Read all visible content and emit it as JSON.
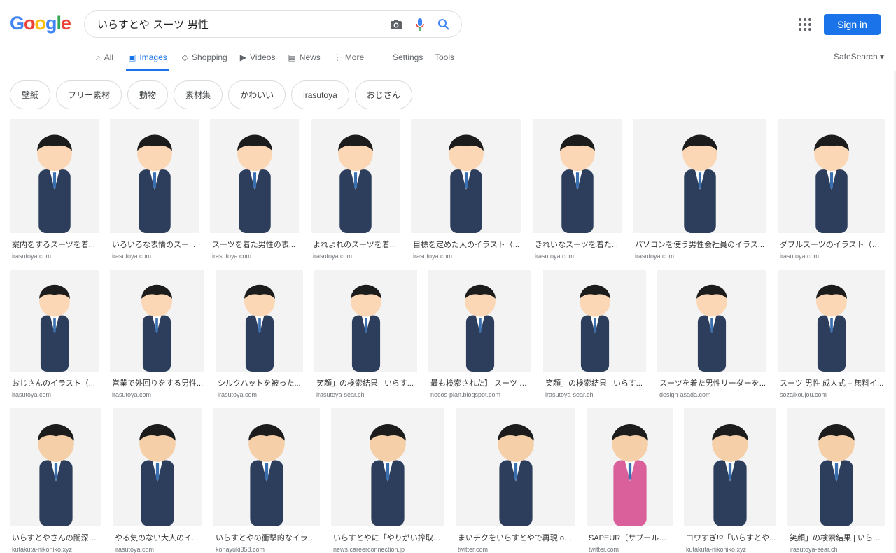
{
  "header": {
    "logo": "Google",
    "query": "いらすとや スーツ 男性",
    "sign_in": "Sign in"
  },
  "tabs": [
    {
      "label": "All",
      "icon": "search-icon"
    },
    {
      "label": "Images",
      "icon": "image-icon",
      "active": true
    },
    {
      "label": "Shopping",
      "icon": "tag-icon"
    },
    {
      "label": "Videos",
      "icon": "play-icon"
    },
    {
      "label": "News",
      "icon": "news-icon"
    },
    {
      "label": "More",
      "icon": "more-icon"
    }
  ],
  "settings": "Settings",
  "tools": "Tools",
  "safesearch": "SafeSearch",
  "chips": [
    "壁紙",
    "フリー素材",
    "動物",
    "素材集",
    "かわいい",
    "irasutoya",
    "おじさん"
  ],
  "colors": {
    "accent": "#1a73e8",
    "suit": "#2c3e5c"
  },
  "results": [
    [
      {
        "title": "案内をするスーツを着...",
        "source": "irasutoya.com"
      },
      {
        "title": "いろいろな表情のスー...",
        "source": "irasutoya.com"
      },
      {
        "title": "スーツを着た男性の表...",
        "source": "irasutoya.com"
      },
      {
        "title": "よれよれのスーツを着...",
        "source": "irasutoya.com"
      },
      {
        "title": "目標を定めた人のイラスト（...",
        "source": "irasutoya.com"
      },
      {
        "title": "きれいなスーツを着た...",
        "source": "irasutoya.com"
      },
      {
        "title": "パソコンを使う男性会社員のイラス...",
        "source": "irasutoya.com"
      },
      {
        "title": "ダブルスーツのイラスト（男...",
        "source": "irasutoya.com"
      }
    ],
    [
      {
        "title": "おじさんのイラスト（...",
        "source": "irasutoya.com"
      },
      {
        "title": "営業で外回りをする男性...",
        "source": "irasutoya.com"
      },
      {
        "title": "シルクハットを被った...",
        "source": "irasutoya.com"
      },
      {
        "title": "笑顔」の検索結果 | いらす...",
        "source": "irasutoya-sear.ch"
      },
      {
        "title": "最も検索された】 スーツ 男...",
        "source": "necos-plan.blogspot.com"
      },
      {
        "title": "笑顔」の検索結果 | いらす...",
        "source": "irasutoya-sear.ch"
      },
      {
        "title": "スーツを着た男性リーダーを...",
        "source": "design-asada.com"
      },
      {
        "title": "スーツ 男性 成人式 – 無料イ...",
        "source": "sozaikoujou.com"
      }
    ],
    [
      {
        "title": "いらすとやさんの闇深い...",
        "source": "kutakuta-nikoniko.xyz"
      },
      {
        "title": "やる気のない大人のイ...",
        "source": "irasutoya.com"
      },
      {
        "title": "いらすとやの衝撃的なイラス...",
        "source": "konayuki358.com"
      },
      {
        "title": "いらすとやに「やりがい搾取」...",
        "source": "news.careerconnection.jp"
      },
      {
        "title": "まいチクをいらすとやで再現 on ...",
        "source": "twitter.com"
      },
      {
        "title": "SAPEUR（サプール）...",
        "source": "twitter.com"
      },
      {
        "title": "コワすぎ!?「いらすとや...",
        "source": "kutakuta-nikoniko.xyz"
      },
      {
        "title": "笑顔」の検索結果 | いらす...",
        "source": "irasutoya-sear.ch"
      }
    ]
  ]
}
